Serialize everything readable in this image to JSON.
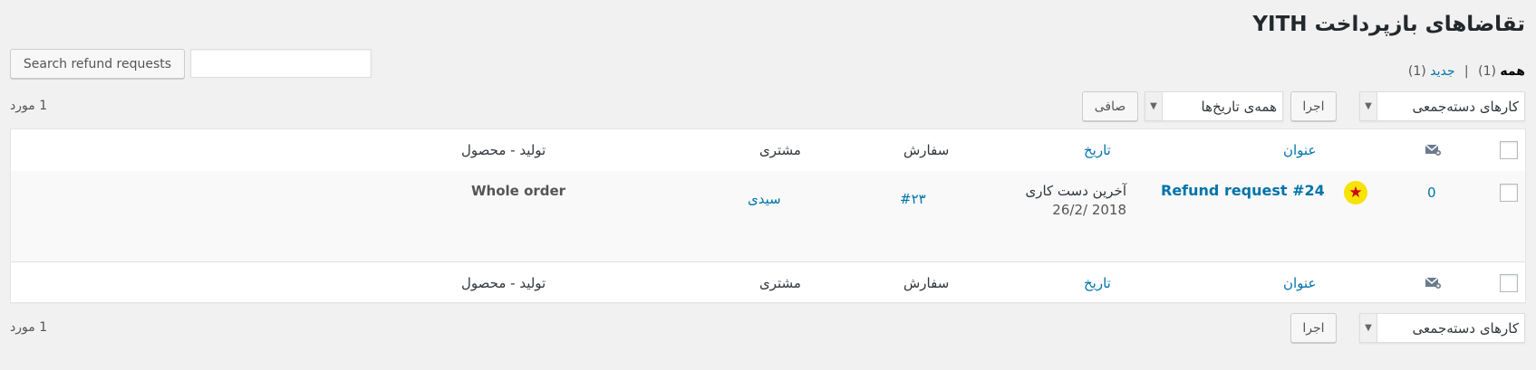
{
  "page": {
    "title": "تقاضاهای بازپرداخت YITH"
  },
  "search": {
    "button_label": "Search refund requests",
    "input_value": ""
  },
  "views": {
    "all_label": "همه",
    "all_count": "(1)",
    "separator": "|",
    "new_label": "جدید",
    "new_count": "(1)"
  },
  "tablenav_top": {
    "bulk_action_selected": "کارهای دسته‌جمعی",
    "apply_label": "اجرا",
    "date_filter_selected": "همه‌ی تاریخ‌ها",
    "filter_label": "صافی",
    "items_count": "1 مورد"
  },
  "tablenav_bottom": {
    "bulk_action_selected": "کارهای دسته‌جمعی",
    "apply_label": "اجرا",
    "items_count": "1 مورد"
  },
  "columns": {
    "icon": "mail-icon",
    "title": "عنوان",
    "date": "تاریخ",
    "order": "سفارش",
    "customer": "مشتری",
    "product": "تولید - محصول"
  },
  "rows": [
    {
      "messages_count": "0",
      "status_icon": "star-icon",
      "title": "Refund request #24",
      "date_label": "آخرین دست کاری",
      "date_value": "2018 /26/2",
      "order": "#۲۳",
      "customer": "سیدی",
      "product": "Whole order"
    }
  ],
  "colors": {
    "link": "#0073aa",
    "star_bg": "#f6e400",
    "star": "#d0021b"
  }
}
